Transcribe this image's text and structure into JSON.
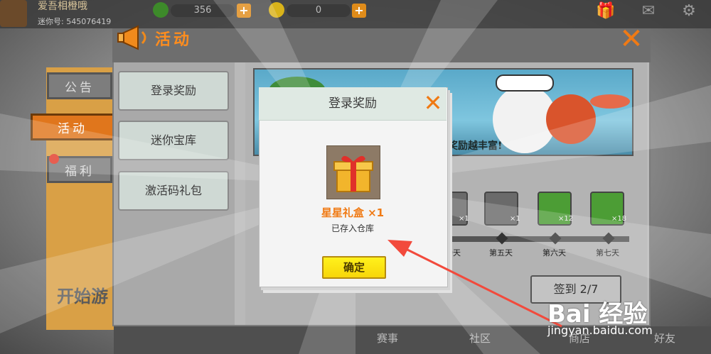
{
  "user": {
    "nickname": "爱吾相橙哦",
    "mini_id": "迷你号: 545076419"
  },
  "resources": [
    {
      "name": "mini-bean",
      "value": "356",
      "color": "#3d8a2a"
    },
    {
      "name": "mini-coin",
      "value": "0",
      "color": "#d9b31a"
    }
  ],
  "side_tabs": [
    {
      "label": "公告",
      "active": false
    },
    {
      "label": "活动",
      "active": true
    },
    {
      "label": "福利",
      "active": false
    }
  ],
  "start_game": "开始游",
  "panel": {
    "title": "活动",
    "close_icon": "close-x-icon"
  },
  "menu": [
    "登录奖励",
    "迷你宝库",
    "激活码礼包"
  ],
  "banner": {
    "text": "奖励越丰富!"
  },
  "days": [
    {
      "label": "9天",
      "count": "×1",
      "icon": "gift-icon"
    },
    {
      "label": "第五天",
      "count": "×1",
      "icon": "item-icon"
    },
    {
      "label": "第六天",
      "count": "×12",
      "icon": "mini-bean-icon"
    },
    {
      "label": "第七天",
      "count": "×18",
      "icon": "mini-bean-icon"
    }
  ],
  "sign_button": "签到 2/7",
  "bottom_nav": [
    "赛事",
    "社区",
    "商店",
    "好友"
  ],
  "dialog": {
    "title": "登录奖励",
    "item_name": "星星礼盒 ×1",
    "status": "已存入仓库",
    "ok_label": "确定"
  },
  "watermark": {
    "brand": "Bai 经验",
    "url": "jingyan.baidu.com"
  },
  "colors": {
    "accent": "#f07a14",
    "ok_yellow": "#f7d60a",
    "arrow_red": "#f24a3c"
  }
}
